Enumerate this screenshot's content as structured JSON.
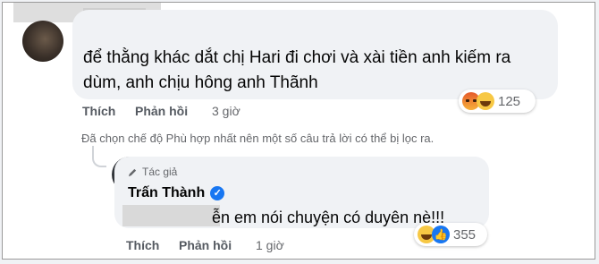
{
  "comment1": {
    "text": "để thằng khác dắt chị Hari đi chơi và xài tiền anh kiếm ra dùm, anh chịu hông anh Thãnh",
    "like_label": "Thích",
    "reply_label": "Phản hồi",
    "time": "3 giờ",
    "reaction_count": "125",
    "reactions": [
      "angry-icon",
      "haha-icon"
    ]
  },
  "filter_note": "Đã chọn chế độ Phù hợp nhất nên một số câu trả lời có thể bị lọc ra.",
  "comment2": {
    "author_badge": "Tác giả",
    "author_name": "Trấn Thành",
    "text": "ễn em nói chuyện có duyên nè!!!",
    "like_label": "Thích",
    "reply_label": "Phản hồi",
    "time": "1 giờ",
    "reaction_count": "355",
    "reactions": [
      "haha-icon",
      "like-icon"
    ]
  },
  "colors": {
    "bubble": "#f0f2f5",
    "text": "#050505",
    "secondary": "#65676b",
    "verified": "#1877f2"
  }
}
